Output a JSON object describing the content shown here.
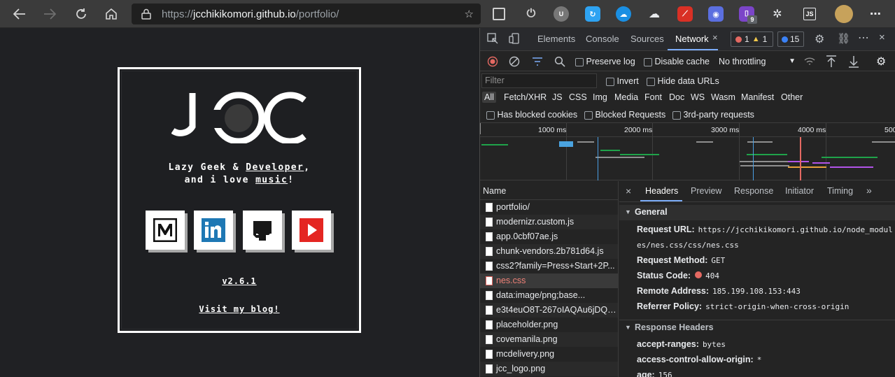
{
  "browser": {
    "url_scheme": "https://",
    "url_host": "jcchikikomori.github.io",
    "url_path": "/portfolio/",
    "ext_badge": "9"
  },
  "site": {
    "tagline_line1_prefix": "Lazy Geek & ",
    "tagline_link1": "Developer",
    "tagline_line1_suffix": ",",
    "tagline_line2_prefix": "and i love ",
    "tagline_link2": "music",
    "tagline_line2_suffix": "!",
    "version": "v2.6.1",
    "blog_link": "Visit my blog!",
    "social_icons": [
      "medium-icon",
      "linkedin-icon",
      "github-icon",
      "youtube-icon"
    ]
  },
  "devtools": {
    "tabs": [
      "Elements",
      "Console",
      "Sources",
      "Network"
    ],
    "active_tab": "Network",
    "errors": "1",
    "warnings": "1",
    "issues": "15",
    "preserve_log": "Preserve log",
    "disable_cache": "Disable cache",
    "throttling": "No throttling",
    "filter_placeholder": "Filter",
    "invert": "Invert",
    "hide_data_urls": "Hide data URLs",
    "filter_types": [
      "All",
      "Fetch/XHR",
      "JS",
      "CSS",
      "Img",
      "Media",
      "Font",
      "Doc",
      "WS",
      "Wasm",
      "Manifest",
      "Other"
    ],
    "has_blocked_cookies": "Has blocked cookies",
    "blocked_requests": "Blocked Requests",
    "third_party": "3rd-party requests",
    "timeline_ticks": [
      "1000 ms",
      "2000 ms",
      "3000 ms",
      "4000 ms",
      "500"
    ],
    "name_header": "Name",
    "requests": [
      {
        "name": "portfolio/",
        "error": false
      },
      {
        "name": "modernizr.custom.js",
        "error": false
      },
      {
        "name": "app.0cbf07ae.js",
        "error": false
      },
      {
        "name": "chunk-vendors.2b781d64.js",
        "error": false
      },
      {
        "name": "css2?family=Press+Start+2P...",
        "error": false
      },
      {
        "name": "nes.css",
        "error": true
      },
      {
        "name": "data:image/png;base...",
        "error": false
      },
      {
        "name": "e3t4euO8T-267oIAQAu6jDQy...",
        "error": false
      },
      {
        "name": "placeholder.png",
        "error": false
      },
      {
        "name": "covemanila.png",
        "error": false
      },
      {
        "name": "mcdelivery.png",
        "error": false
      },
      {
        "name": "jcc_logo.png",
        "error": false
      }
    ],
    "detail_tabs": [
      "Headers",
      "Preview",
      "Response",
      "Initiator",
      "Timing"
    ],
    "general_title": "General",
    "request_url_label": "Request URL:",
    "request_url_1": "https://jcchikikomori.github.io/node_modul",
    "request_url_2": "es/nes.css/css/nes.css",
    "request_method_label": "Request Method:",
    "request_method": "GET",
    "status_code_label": "Status Code:",
    "status_code": "404",
    "remote_address_label": "Remote Address:",
    "remote_address": "185.199.108.153:443",
    "referrer_policy_label": "Referrer Policy:",
    "referrer_policy": "strict-origin-when-cross-origin",
    "response_headers_title": "Response Headers",
    "accept_ranges_label": "accept-ranges:",
    "accept_ranges": "bytes",
    "acao_label": "access-control-allow-origin:",
    "acao": "*",
    "age_label": "age:",
    "age": "156"
  },
  "colors": {
    "error": "#e46962",
    "accent": "#7cacf8",
    "warning": "#f2c94c",
    "issues": "#3b82f6"
  }
}
